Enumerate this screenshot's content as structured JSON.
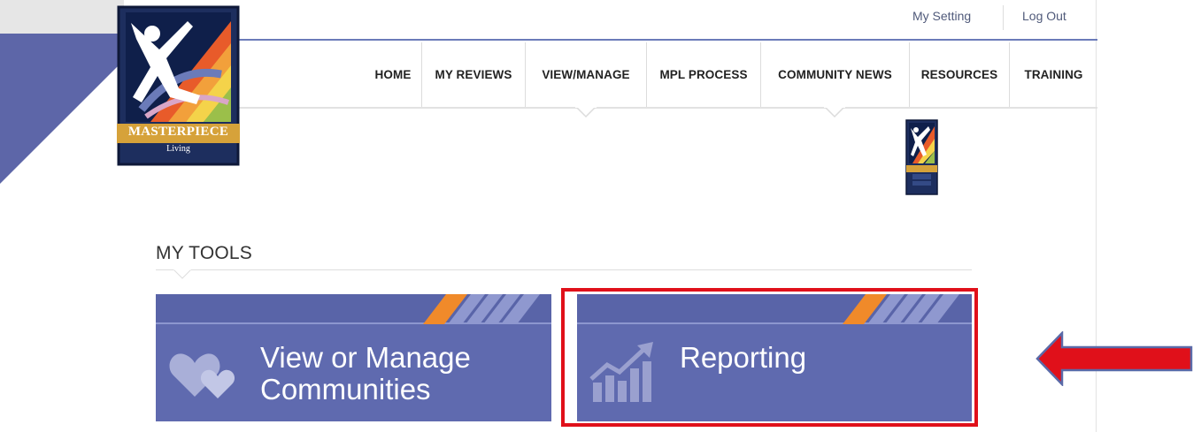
{
  "header": {
    "logo_text": "MASTERPIECE",
    "logo_subtext": "Living",
    "utility_links": [
      "My Setting",
      "Log Out"
    ]
  },
  "nav": {
    "items": [
      "HOME",
      "MY REVIEWS",
      "VIEW/MANAGE",
      "MPL PROCESS",
      "COMMUNITY NEWS",
      "RESOURCES",
      "TRAINING"
    ]
  },
  "tools": {
    "title": "MY TOOLS",
    "tiles": [
      {
        "label_line1": "View or Manage",
        "label_line2": "Communities",
        "icon": "hearts-icon"
      },
      {
        "label_line1": "Reporting",
        "label_line2": "",
        "icon": "growth-chart-icon"
      }
    ]
  },
  "annotations": {
    "highlight_color": "#e0101a",
    "arrow_color": "#e0101a"
  },
  "colors": {
    "brand_blue": "#5f6aaf",
    "nav_rule": "#6b7bb9"
  }
}
